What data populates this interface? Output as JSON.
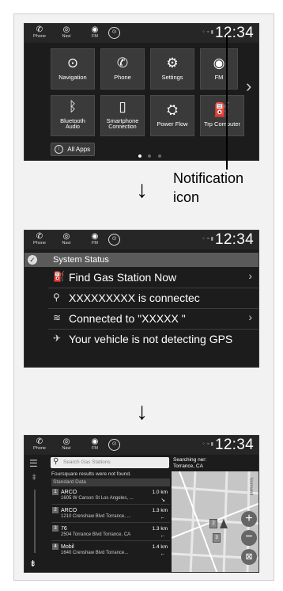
{
  "screen1": {
    "status": {
      "phone": "Phone",
      "navi": "Navi",
      "fm": "FM",
      "clock": "12:34",
      "phone_icon": "phone-icon",
      "navi_icon": "navi-icon",
      "fm_icon": "radio-icon"
    },
    "tiles": [
      {
        "label": "Navigation",
        "icon": "navigation-icon"
      },
      {
        "label": "Phone",
        "icon": "phone-icon"
      },
      {
        "label": "Settings",
        "icon": "gear-icon"
      },
      {
        "label": "FM",
        "icon": "radio-icon"
      },
      {
        "label1": "Bluetooth",
        "label2": "Audio",
        "icon": "bluetooth-icon"
      },
      {
        "label1": "Smartphone",
        "label2": "Connection",
        "icon": "smartphone-icon"
      },
      {
        "label": "Power Flow",
        "icon": "power-flow-icon"
      },
      {
        "label": "Trp Computer",
        "icon": "fuel-icon"
      }
    ],
    "all_apps": "All Apps",
    "page_dots": 3,
    "active_page": 1
  },
  "callout": {
    "line1": "Notification",
    "line2": "icon"
  },
  "screen2": {
    "clock": "12:34",
    "header": "System Status",
    "rows": [
      {
        "icon": "fuel-icon",
        "text": "Find Gas Station Now",
        "chevron": true
      },
      {
        "icon": "usb-icon",
        "text": "XXXXXXXXX  is connectec",
        "chevron": false
      },
      {
        "icon": "wifi-icon",
        "text": "Connected to \"XXXXX \"",
        "chevron": true
      },
      {
        "icon": "gps-icon",
        "text": "Your vehicle is not detecting GPS",
        "chevron": false
      }
    ]
  },
  "screen3": {
    "clock": "12:34",
    "search_placeholder": "Search Gas Stations",
    "searching_label": "Searching ner:",
    "searching_location": "Torrance, CA",
    "no_results": "Foursquare results were not found.",
    "standard_data": "Standard Data",
    "map_label": "Normand",
    "results": [
      {
        "num": "1",
        "name": "ARCO",
        "address": "1605 W Carson St Los Angeles, ...",
        "distance": "1.0 km",
        "dir": "↘"
      },
      {
        "num": "2",
        "name": "ARCO",
        "address": "1210 Crenshaw Blvd Torrance, ...",
        "distance": "1.3 km",
        "dir": "←"
      },
      {
        "num": "3",
        "name": "76",
        "address": "2504 Torrance Blvd Torrance, CA",
        "distance": "1.3 km",
        "dir": "←"
      },
      {
        "num": "4",
        "name": "Mobil",
        "address": "1640 Crenshaw Blvd Torrance...",
        "distance": "1.4 km",
        "dir": "←"
      }
    ]
  }
}
